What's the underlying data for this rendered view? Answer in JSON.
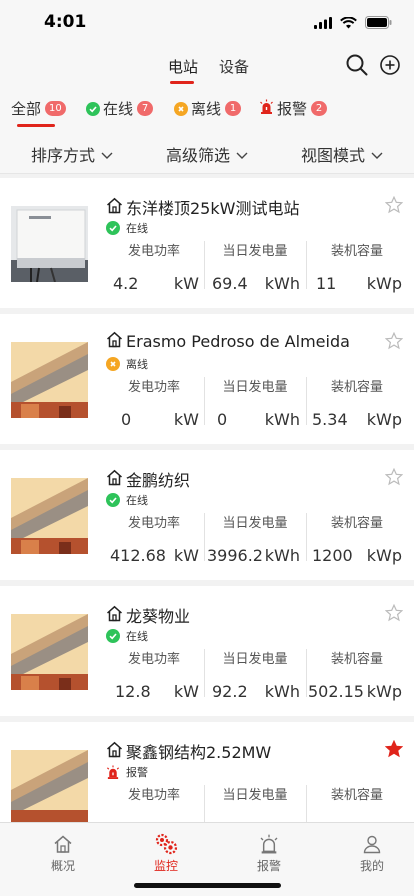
{
  "status_bar": {
    "time": "4:01"
  },
  "top_nav": {
    "tabs": [
      {
        "label": "电站"
      },
      {
        "label": "设备"
      }
    ]
  },
  "filter_tabs": [
    {
      "label": "全部",
      "count": "10"
    },
    {
      "label": "在线",
      "count": "7"
    },
    {
      "label": "离线",
      "count": "1"
    },
    {
      "label": "报警",
      "count": "2"
    }
  ],
  "sort_bar": {
    "sort": "排序方式",
    "filter": "高级筛选",
    "view": "视图模式"
  },
  "metric_labels": {
    "power": "发电功率",
    "daily": "当日发电量",
    "capacity": "装机容量"
  },
  "colors": {
    "accent": "#e0241b",
    "online": "#2ec35a",
    "offline": "#f5a623",
    "alarm": "#e0241b"
  },
  "stations": [
    {
      "name": "东洋楼顶25kW测试电站",
      "status": "在线",
      "status_type": "online",
      "favorite": false,
      "power": "4.2",
      "power_unit": "kW",
      "daily": "69.4",
      "daily_unit": "kWh",
      "capacity": "11",
      "capacity_unit": "kWp"
    },
    {
      "name": "Erasmo Pedroso de Almeida",
      "status": "离线",
      "status_type": "offline",
      "favorite": false,
      "power": "0",
      "power_unit": "kW",
      "daily": "0",
      "daily_unit": "kWh",
      "capacity": "5.34",
      "capacity_unit": "kWp"
    },
    {
      "name": "金鹏纺织",
      "status": "在线",
      "status_type": "online",
      "favorite": false,
      "power": "412.68",
      "power_unit": "kW",
      "daily": "3996.2",
      "daily_unit": "kWh",
      "capacity": "1200",
      "capacity_unit": "kWp"
    },
    {
      "name": "龙葵物业",
      "status": "在线",
      "status_type": "online",
      "favorite": false,
      "power": "12.8",
      "power_unit": "kW",
      "daily": "92.2",
      "daily_unit": "kWh",
      "capacity": "502.15",
      "capacity_unit": "kWp"
    },
    {
      "name": "聚鑫钢结构2.52MW",
      "status": "报警",
      "status_type": "alarm",
      "favorite": true,
      "power": "",
      "power_unit": "",
      "daily": "",
      "daily_unit": "",
      "capacity": "",
      "capacity_unit": ""
    }
  ],
  "tab_bar": [
    {
      "label": "概况",
      "icon": "home-icon"
    },
    {
      "label": "监控",
      "icon": "gears-icon"
    },
    {
      "label": "报警",
      "icon": "alarm-light-icon"
    },
    {
      "label": "我的",
      "icon": "person-icon"
    }
  ]
}
